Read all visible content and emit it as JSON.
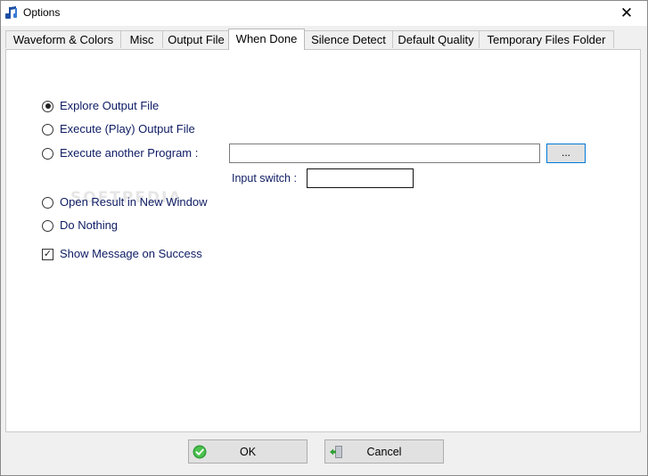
{
  "window": {
    "title": "Options",
    "close_glyph": "✕",
    "app_icon": "music-note-icon"
  },
  "tabs": [
    {
      "label": "Waveform & Colors",
      "active": false
    },
    {
      "label": "Misc",
      "active": false
    },
    {
      "label": "Output File",
      "active": false
    },
    {
      "label": "When Done",
      "active": true
    },
    {
      "label": "Silence Detect",
      "active": false
    },
    {
      "label": "Default Quality",
      "active": false
    },
    {
      "label": "Temporary Files Folder",
      "active": false
    }
  ],
  "when_done": {
    "explore_label": "Explore Output File",
    "execute_play_label": "Execute (Play) Output File",
    "execute_program_label": "Execute another Program :",
    "program_path_value": "",
    "browse_label": "...",
    "input_switch_label": "Input switch :",
    "input_switch_value": "",
    "open_result_label": "Open Result in New Window",
    "do_nothing_label": "Do Nothing",
    "show_message_label": "Show Message on Success",
    "selected_option": "explore",
    "show_message_checked": true,
    "checkmark_glyph": "✓"
  },
  "watermark": "SOFTPEDIA",
  "buttons": {
    "ok_label": "OK",
    "ok_icon": "green-check-icon",
    "cancel_label": "Cancel",
    "cancel_icon": "exit-door-icon"
  },
  "colors": {
    "label_text": "#0d1b63",
    "focus_border": "#0078d7"
  }
}
